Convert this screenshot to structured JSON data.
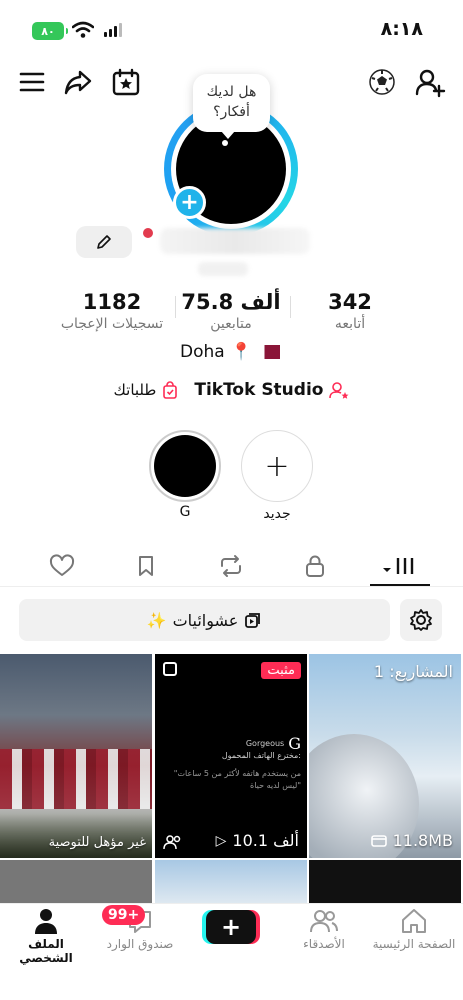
{
  "status_bar": {
    "time": "٨:١٨",
    "battery": "٨٠"
  },
  "avatar": {
    "tooltip": "هل لديك أفكار؟",
    "add_badge": "+"
  },
  "stats": [
    {
      "value": "342",
      "label": "أتابعه"
    },
    {
      "value": "75.8 ألف",
      "label": "متابعين"
    },
    {
      "value": "1182",
      "label": "تسجيلات الإعجاب"
    }
  ],
  "location": {
    "text": "Doha"
  },
  "links": {
    "studio": "TikTok Studio",
    "orders": "طلباتك"
  },
  "highlights": [
    {
      "label": "جديد",
      "icon": "+"
    },
    {
      "label": "G"
    }
  ],
  "shuffle": {
    "label": "عشوائيات",
    "emoji": "✨"
  },
  "grid": [
    {
      "label": "المشاريع: 1",
      "size": "11.8MB"
    },
    {
      "pinned": "مثبت",
      "views": "10.1 ألف",
      "author": "Gorgeous",
      "post_title": "مخترع الهاتف المحمول:",
      "post_quote": "\"من يستخدم هاتفه لأكثر من 5 ساعات ليس لديه حياة\""
    },
    {
      "label": "غير مؤهل للتوصية"
    }
  ],
  "nav": {
    "home": "الصفحة الرئيسية",
    "friends": "الأصدقاء",
    "create": "+",
    "inbox": "صندوق الوارد",
    "inbox_badge": "99+",
    "profile": "الملف الشخصي"
  },
  "colors": {
    "accent": "#fe2c55",
    "cyan": "#25f4ee",
    "ring": "#1da1f2"
  }
}
